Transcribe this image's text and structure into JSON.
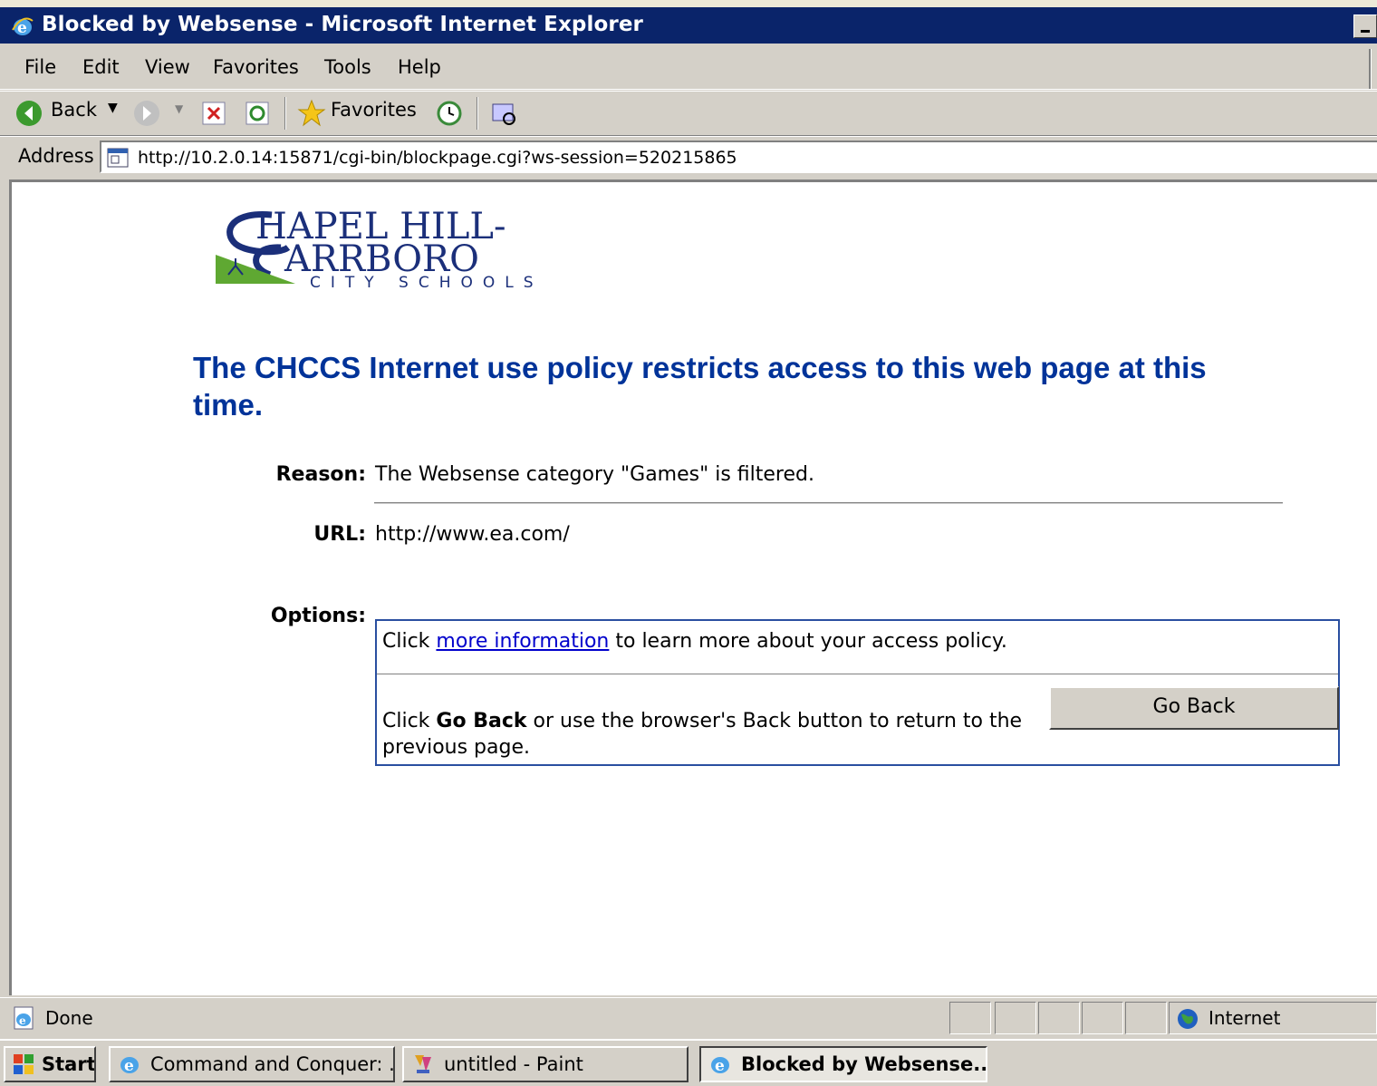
{
  "window": {
    "title": "Blocked by Websense - Microsoft Internet Explorer"
  },
  "menu": [
    "File",
    "Edit",
    "View",
    "Favorites",
    "Tools",
    "Help"
  ],
  "toolbar": {
    "back_label": "Back",
    "favorites_label": "Favorites"
  },
  "address": {
    "label": "Address",
    "url": "http://10.2.0.14:15871/cgi-bin/blockpage.cgi?ws-session=520215865"
  },
  "logo": {
    "line1": "HAPEL HILL-",
    "line2": "ARRBORO",
    "line3": "CITY SCHOOLS",
    "colors": {
      "navy": "#1b2f7a",
      "green": "#5fa832"
    }
  },
  "page": {
    "heading": "The CHCCS Internet use policy restricts access to this web page at this time.",
    "reason_label": "Reason:",
    "reason_value": "The Websense category \"Games\" is filtered.",
    "url_label": "URL:",
    "url_value": "http://www.ea.com/",
    "options_label": "Options:",
    "option1_pre": "Click ",
    "option1_link": "more information",
    "option1_post": " to learn more about your access policy.",
    "option2_pre": "Click ",
    "option2_bold": "Go Back",
    "option2_post": " or use the browser's Back button to return to the previous page.",
    "goback_button": "Go Back",
    "heading_color": "#003399"
  },
  "status": {
    "text": "Done",
    "zone": "Internet"
  },
  "taskbar": {
    "start_label": "Start",
    "items": [
      {
        "label": "Command and Conquer: ...",
        "active": false
      },
      {
        "label": "untitled - Paint",
        "active": false
      },
      {
        "label": "Blocked by Websense...",
        "active": true
      }
    ]
  }
}
